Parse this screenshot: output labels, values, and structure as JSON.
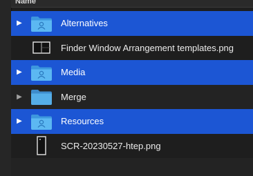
{
  "header": {
    "name_label": "Name"
  },
  "rows": [
    {
      "name": "Alternatives",
      "disclosure": "▶",
      "icon": "folder-person-icon"
    },
    {
      "name": "Finder Window Arrangement templates.png",
      "disclosure": "",
      "icon": "image-file-icon"
    },
    {
      "name": "Media",
      "disclosure": "▶",
      "icon": "folder-person-icon"
    },
    {
      "name": "Merge",
      "disclosure": "▶",
      "icon": "folder-icon"
    },
    {
      "name": "Resources",
      "disclosure": "▶",
      "icon": "folder-person-icon"
    },
    {
      "name": "SCR-20230527-htep.png",
      "disclosure": "",
      "icon": "image-file-icon"
    }
  ],
  "colors": {
    "selection": "#1c56d4",
    "folder": "#54b3f0",
    "background": "#1e1e1e"
  }
}
